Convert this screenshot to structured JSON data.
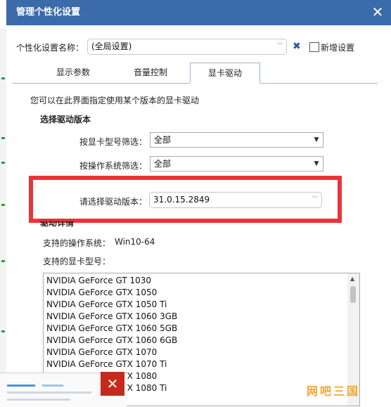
{
  "window": {
    "title": "管理个性化设置"
  },
  "profile": {
    "label": "个性化设置名称：",
    "value": "(全局设置)",
    "new_label": "新增设置"
  },
  "tabs": [
    {
      "label": "显示参数"
    },
    {
      "label": "音量控制"
    },
    {
      "label": "显卡驱动"
    }
  ],
  "driver": {
    "intro": "您可以在此界面指定使用某个版本的显卡驱动",
    "section_title": "选择驱动版本",
    "filter_model_label": "按显卡型号筛选：",
    "filter_model_value": "全部",
    "filter_os_label": "按操作系统筛选：",
    "filter_os_value": "全部",
    "version_label": "请选择驱动版本：",
    "version_value": "31.0.15.2849",
    "details_title": "驱动详情",
    "os_label": "支持的操作系统：",
    "os_value": "Win10-64",
    "models_label": "支持的显卡型号：",
    "models": [
      "NVIDIA GeForce GT 1030",
      "NVIDIA GeForce GTX 1050",
      "NVIDIA GeForce GTX 1050 Ti",
      "NVIDIA GeForce GTX 1060 3GB",
      "NVIDIA GeForce GTX 1060 5GB",
      "NVIDIA GeForce GTX 1060 6GB",
      "NVIDIA GeForce GTX 1070",
      "NVIDIA GeForce GTX 1070 Ti",
      "NVIDIA GeForce GTX 1080",
      "NVIDIA GeForce GTX 1080 Ti"
    ]
  },
  "watermark": "网吧三国",
  "colors": {
    "titlebar": "#3c6bab",
    "highlight": "#e8343a",
    "close": "#c42b1c"
  }
}
